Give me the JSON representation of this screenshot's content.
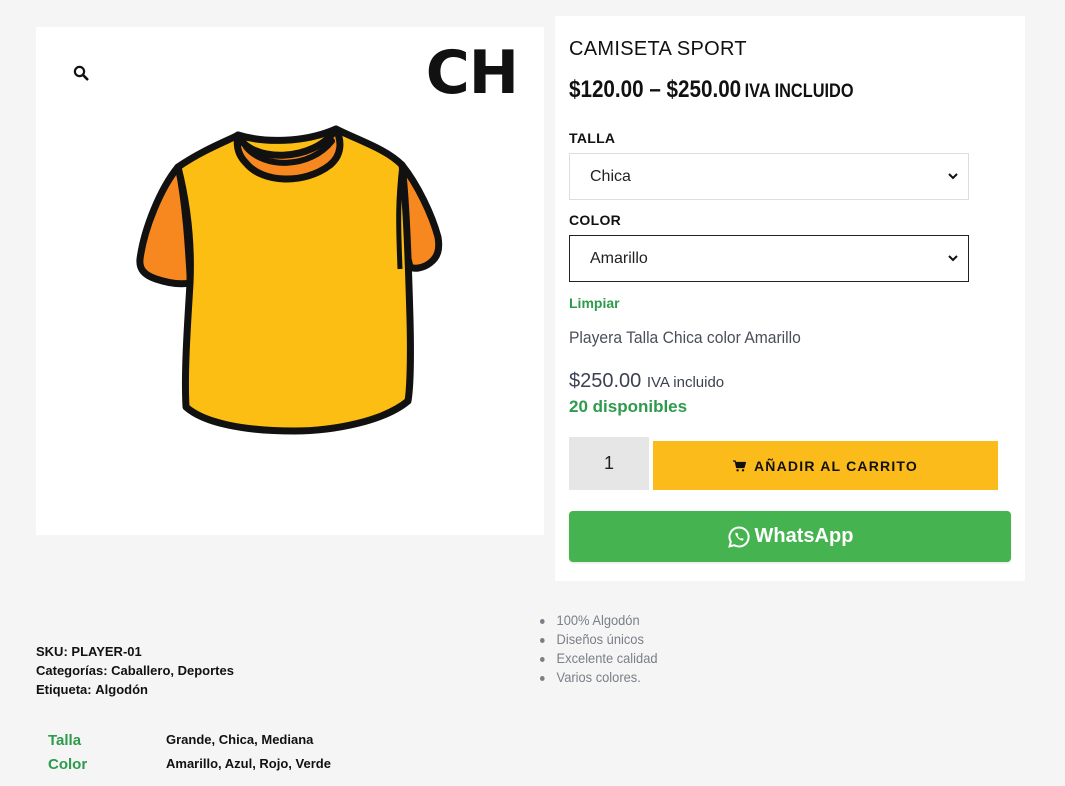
{
  "gallery": {
    "zoom_icon": "search-icon",
    "size_badge": "CH",
    "image": "t-shirt-illustration"
  },
  "product": {
    "title": "CAMISETA SPORT",
    "price_range": "$120.00 – $250.00",
    "price_tax": "IVA INCLUIDO"
  },
  "variations": {
    "size_label": "TALLA",
    "size_value": "Chica",
    "color_label": "COLOR",
    "color_value": "Amarillo",
    "clear_label": "Limpiar"
  },
  "selected_variation": {
    "description": "Playera Talla Chica color Amarillo",
    "price": "$250.00",
    "price_tax": "IVA incluido",
    "stock": "20 disponibles"
  },
  "cart": {
    "quantity": "1",
    "add_label": "AÑADIR AL CARRITO",
    "cart_icon": "cart-icon"
  },
  "whatsapp": {
    "label": "WhatsApp",
    "icon": "whatsapp-icon"
  },
  "features": [
    "100% Algodón",
    "Diseños únicos",
    "Excelente calidad",
    "Varios colores."
  ],
  "meta": {
    "sku_label": "SKU:",
    "sku_value": "PLAYER-01",
    "categories_label": "Categorías:",
    "categories_value": "Caballero, Deportes",
    "tag_label": "Etiqueta:",
    "tag_value": "Algodón"
  },
  "attributes": [
    {
      "name": "Talla",
      "values": "Grande, Chica, Mediana"
    },
    {
      "name": "Color",
      "values": "Amarillo, Azul, Rojo, Verde"
    }
  ],
  "colors": {
    "accent_green": "#2e9a4c",
    "cart_yellow": "#fbbc1b",
    "whatsapp_green": "#45b34f",
    "shirt_yellow": "#fdbe13",
    "shirt_orange": "#f7881f"
  }
}
